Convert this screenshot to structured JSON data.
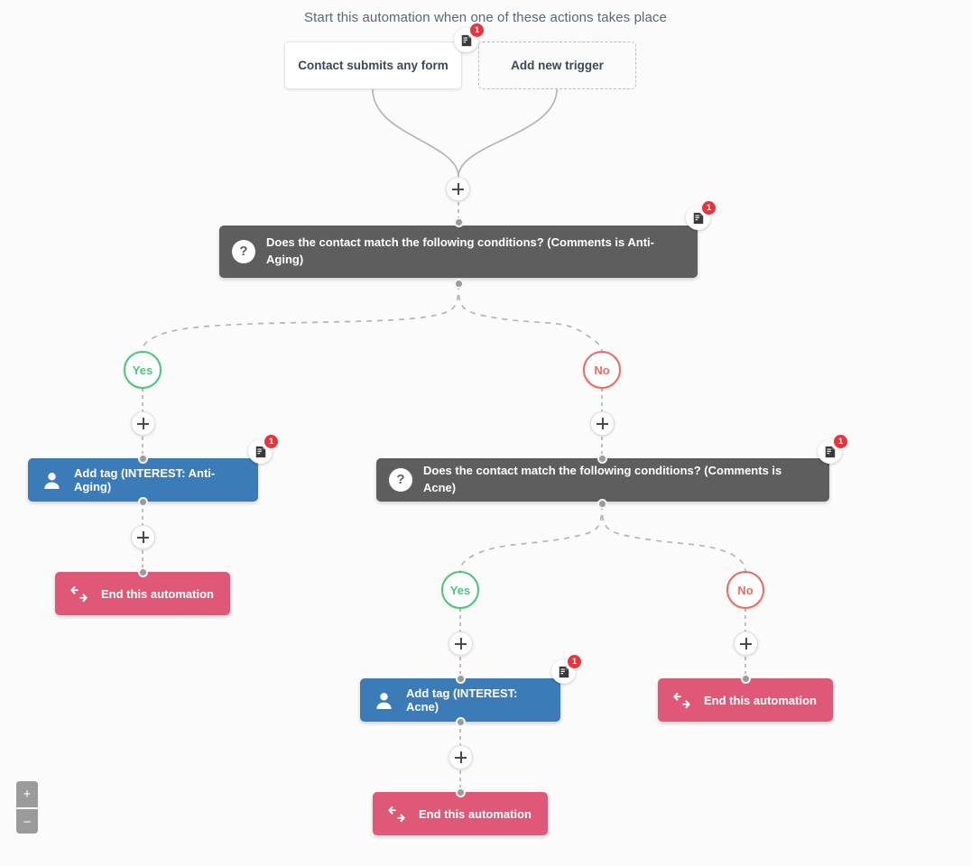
{
  "headline": "Start this automation when one of these actions takes place",
  "colors": {
    "background": "#fbfbfb",
    "condition": "#5e5e5e",
    "action_tag": "#3b7cb8",
    "action_end": "#e05878",
    "yes": "#4cc47c",
    "no": "#ea6b62",
    "badge": "#e8343a",
    "wire": "#b5b5b5"
  },
  "triggers": [
    {
      "label": "Contact submits any form",
      "style": "solid",
      "note_count": "1"
    },
    {
      "label": "Add new trigger",
      "style": "dashed",
      "note_count": null
    }
  ],
  "nodes": {
    "condition_1": {
      "icon": "question-mark-icon",
      "label": "Does the contact match the following conditions? (Comments is Anti-Aging)",
      "note_count": "1"
    },
    "condition_2": {
      "icon": "question-mark-icon",
      "label": "Does the contact match the following conditions? (Comments is Acne)",
      "note_count": "1"
    },
    "add_tag_anti_aging": {
      "icon": "user-icon",
      "label": "Add tag (INTEREST: Anti-Aging)",
      "note_count": "1"
    },
    "add_tag_acne": {
      "icon": "user-icon",
      "label": "Add tag (INTEREST: Acne)",
      "note_count": "1"
    },
    "end_1": {
      "icon": "exchange-arrows-icon",
      "label": "End this automation"
    },
    "end_2": {
      "icon": "exchange-arrows-icon",
      "label": "End this automation"
    },
    "end_3": {
      "icon": "exchange-arrows-icon",
      "label": "End this automation"
    }
  },
  "branches": {
    "yes_1": "Yes",
    "no_1": "No",
    "yes_2": "Yes",
    "no_2": "No"
  },
  "add_step_label": "+",
  "zoom_controls": {
    "zoom_in": "+",
    "zoom_out": "−"
  }
}
